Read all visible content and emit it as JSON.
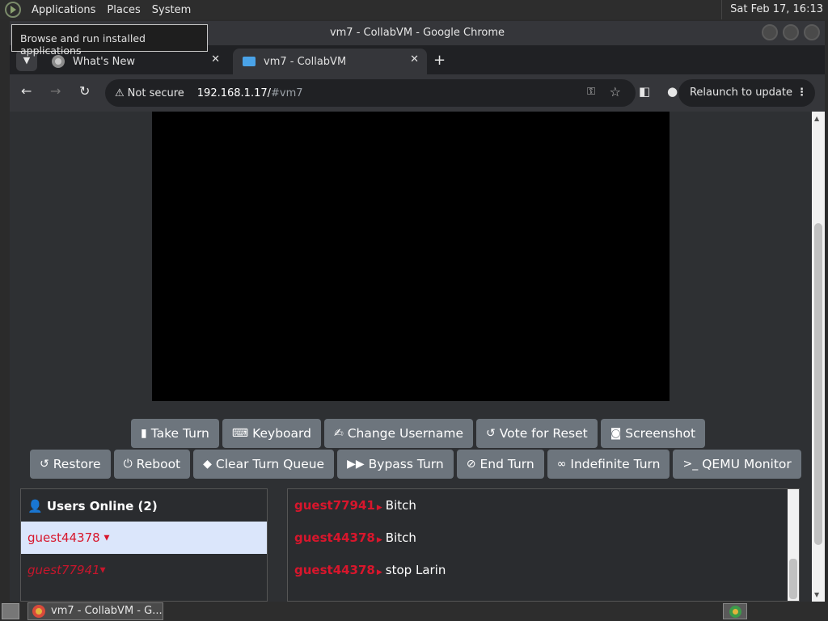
{
  "panel": {
    "menus": [
      "Applications",
      "Places",
      "System"
    ],
    "clock": "Sat Feb 17, 16:13",
    "tooltip": "Browse and run installed applications"
  },
  "window": {
    "title": "vm7 - CollabVM - Google Chrome"
  },
  "tabs": [
    {
      "label": "What's New",
      "icon": "chrome-icon"
    },
    {
      "label": "vm7 - CollabVM",
      "icon": "monitor-icon"
    }
  ],
  "toolbar": {
    "security": "Not secure",
    "url_host": "192.168.1.17/",
    "url_fragment": "#vm7",
    "relaunch": "Relaunch to update"
  },
  "vm_buttons_row1": [
    {
      "label": "Take Turn",
      "icon": "mouse-icon",
      "glyph": "▮"
    },
    {
      "label": "Keyboard",
      "icon": "keyboard-icon",
      "glyph": "⌨"
    },
    {
      "label": "Change Username",
      "icon": "signature-icon",
      "glyph": "✍"
    },
    {
      "label": "Vote for Reset",
      "icon": "undo-icon",
      "glyph": "↺"
    },
    {
      "label": "Screenshot",
      "icon": "camera-icon",
      "glyph": "◙"
    }
  ],
  "vm_buttons_row2": [
    {
      "label": "Restore",
      "icon": "restore-icon",
      "glyph": "↺"
    },
    {
      "label": "Reboot",
      "icon": "power-icon",
      "glyph": "⏻"
    },
    {
      "label": "Clear Turn Queue",
      "icon": "eraser-icon",
      "glyph": "◆"
    },
    {
      "label": "Bypass Turn",
      "icon": "forward-icon",
      "glyph": "▶▶"
    },
    {
      "label": "End Turn",
      "icon": "ban-icon",
      "glyph": "⊘"
    },
    {
      "label": "Indefinite Turn",
      "icon": "infinity-icon",
      "glyph": "∞"
    },
    {
      "label": "QEMU Monitor",
      "icon": "terminal-icon",
      "glyph": ">_"
    }
  ],
  "users": {
    "title": "Users Online (2)",
    "list": [
      "guest44378",
      "guest77941"
    ]
  },
  "chat": [
    {
      "user": "guest77941",
      "text": "Bitch"
    },
    {
      "user": "guest44378",
      "text": "Bitch"
    },
    {
      "user": "guest44378",
      "text": "stop Larin"
    }
  ],
  "taskbar": {
    "item": "vm7 - CollabVM - G..."
  }
}
